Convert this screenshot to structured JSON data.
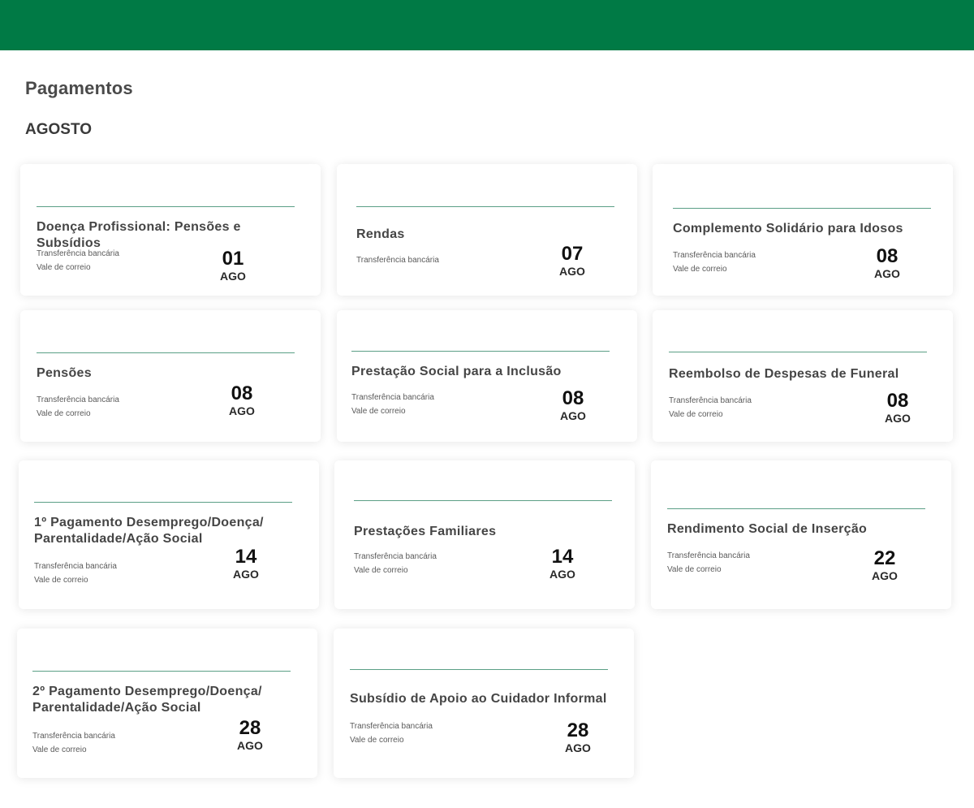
{
  "colors": {
    "brand": "#007a45",
    "line": "#5b9f86"
  },
  "page_title": "Pagamentos",
  "month_title": "AGOSTO",
  "cards": [
    {
      "title": "Doença Profissional: Pensões e Subsídios",
      "methods": [
        "Transferência bancária",
        "Vale de correio"
      ],
      "day": "01",
      "month": "AGO"
    },
    {
      "title": "Rendas",
      "methods": [
        "Transferência bancária"
      ],
      "day": "07",
      "month": "AGO"
    },
    {
      "title": "Complemento Solidário para Idosos",
      "methods": [
        "Transferência bancária",
        "Vale de correio"
      ],
      "day": "08",
      "month": "AGO"
    },
    {
      "title": "Pensões",
      "methods": [
        "Transferência bancária",
        "Vale de correio"
      ],
      "day": "08",
      "month": "AGO"
    },
    {
      "title": "Prestação Social para a Inclusão",
      "methods": [
        "Transferência bancária",
        "Vale de correio"
      ],
      "day": "08",
      "month": "AGO"
    },
    {
      "title": "Reembolso de Despesas de Funeral",
      "methods": [
        "Transferência bancária",
        "Vale de correio"
      ],
      "day": "08",
      "month": "AGO"
    },
    {
      "title": "1º Pagamento Desemprego/Doença/ Parentalidade/Ação Social",
      "methods": [
        "Transferência bancária",
        "Vale de correio"
      ],
      "day": "14",
      "month": "AGO"
    },
    {
      "title": "Prestações Familiares",
      "methods": [
        "Transferência bancária",
        "Vale de correio"
      ],
      "day": "14",
      "month": "AGO"
    },
    {
      "title": "Rendimento Social de Inserção",
      "methods": [
        "Transferência bancária",
        "Vale de correio"
      ],
      "day": "22",
      "month": "AGO"
    },
    {
      "title": "2º Pagamento Desemprego/Doença/ Parentalidade/Ação Social",
      "methods": [
        "Transferência bancária",
        "Vale de correio"
      ],
      "day": "28",
      "month": "AGO"
    },
    {
      "title": "Subsídio de Apoio ao Cuidador Informal",
      "methods": [
        "Transferência bancária",
        "Vale de correio"
      ],
      "day": "28",
      "month": "AGO"
    }
  ]
}
